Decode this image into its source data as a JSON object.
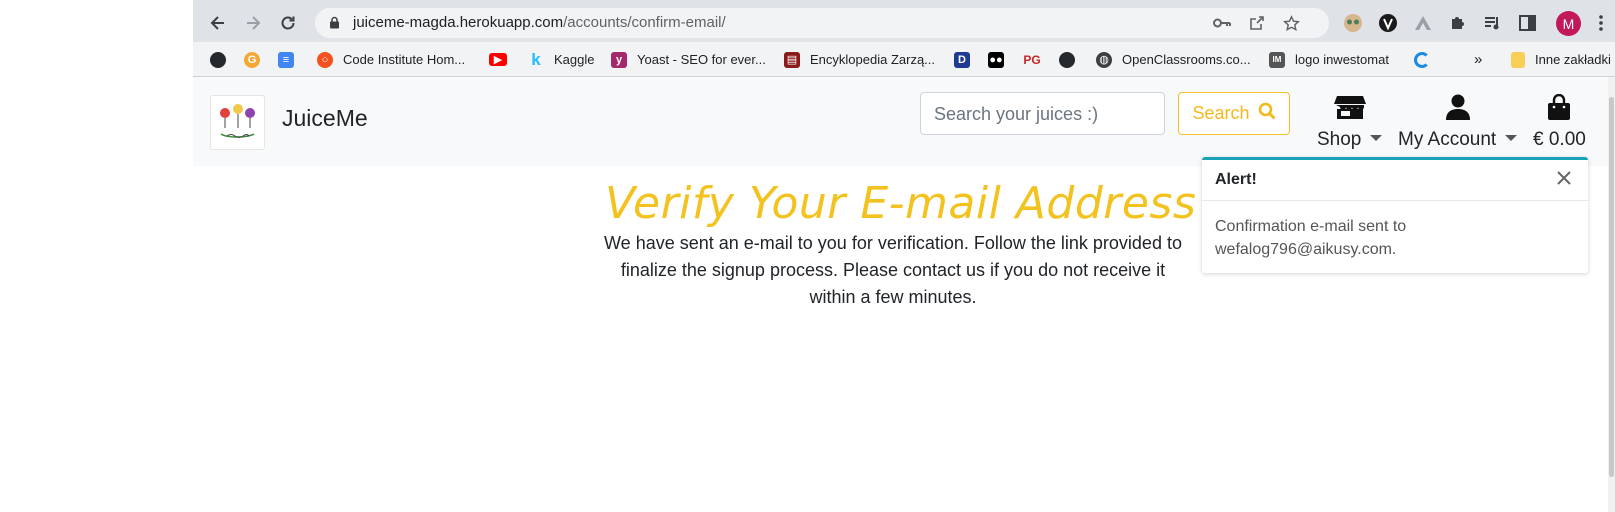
{
  "browser": {
    "url_host": "juiceme-magda.herokuapp.com",
    "url_path": "/accounts/confirm-email/",
    "avatar_letter": "M"
  },
  "bookmarks": [
    {
      "label": "",
      "icon": "github-icon",
      "color": "#24292e"
    },
    {
      "label": "",
      "icon": "grammarly-icon",
      "color": "#f4a732"
    },
    {
      "label": "",
      "icon": "docs-icon",
      "color": "#4285f4"
    },
    {
      "label": "Code Institute Hom...",
      "icon": "code-institute-icon",
      "color": "#f4511e"
    },
    {
      "label": "",
      "icon": "youtube-icon",
      "color": "#ff0000"
    },
    {
      "label": "Kaggle",
      "icon": "kaggle-icon",
      "color": "#20beff"
    },
    {
      "label": "Yoast - SEO for ever...",
      "icon": "yoast-icon",
      "color": "#a4286a"
    },
    {
      "label": "Encyklopedia Zarzą...",
      "icon": "encyclopedia-icon",
      "color": "#8b1a1a"
    },
    {
      "label": "",
      "icon": "d-icon",
      "color": "#1f3a93"
    },
    {
      "label": "",
      "icon": "medium-icon",
      "color": "#000000"
    },
    {
      "label": "",
      "icon": "pg-icon",
      "color": "#c62828"
    },
    {
      "label": "",
      "icon": "github-icon",
      "color": "#24292e"
    },
    {
      "label": "OpenClassrooms.co...",
      "icon": "globe-icon",
      "color": "#3c4043"
    },
    {
      "label": "logo inwestomat",
      "icon": "inwestomat-icon",
      "color": "#555555"
    },
    {
      "label": "",
      "icon": "loader-icon",
      "color": "#1e88e5"
    },
    {
      "label": "»",
      "icon": "",
      "color": ""
    },
    {
      "label": "Inne zakładki",
      "icon": "folder-icon",
      "color": "#f6cf57"
    }
  ],
  "navbar": {
    "brand": "JuiceMe",
    "search_placeholder": "Search your juices :)",
    "search_button": "Search",
    "shop_label": "Shop",
    "account_label": "My Account",
    "bag_total": "€ 0.00"
  },
  "main": {
    "heading": "Verify Your E-mail Address",
    "body": "We have sent an e-mail to you for verification. Follow the link provided to finalize the signup process. Please contact us if you do not receive it within a few minutes."
  },
  "toast": {
    "title": "Alert!",
    "message": "Confirmation e-mail sent to wefalog796@aikusy.com.",
    "accent": "#17a2b8"
  },
  "colors": {
    "heading": "#f4c21f",
    "search_button": "#f4b81c"
  }
}
